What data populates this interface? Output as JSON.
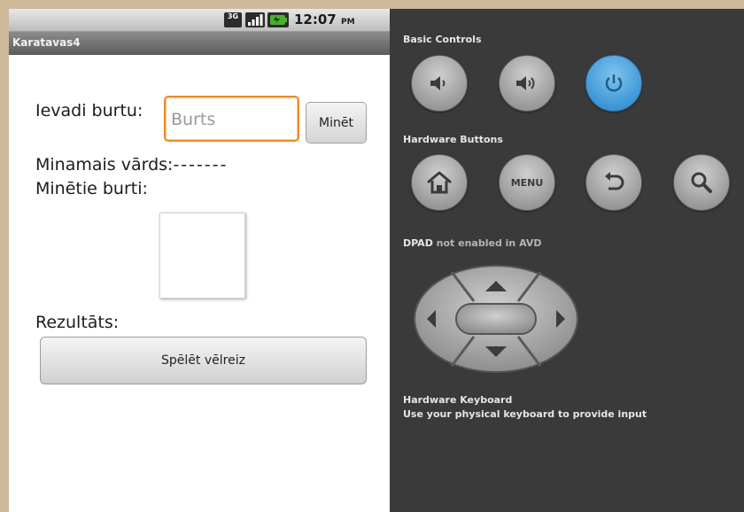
{
  "status_bar": {
    "network_badge": "3G",
    "time": "12:07",
    "ampm": "PM",
    "icons": [
      "3g-icon",
      "signal-icon",
      "battery-charging-icon"
    ]
  },
  "app": {
    "title": "Karatavas4",
    "enter_letter_label": "Ievadi burtu:",
    "letter_input_placeholder": "Burts",
    "letter_input_value": "",
    "guess_button": "Minēt",
    "word_label": "Minamais vārds:",
    "word_mask": "-------",
    "guessed_label": "Minētie burti:",
    "result_label": "Rezultāts:",
    "replay_button": "Spēlēt vēlreiz"
  },
  "controls": {
    "basic_controls_title": "Basic Controls",
    "hardware_buttons_title": "Hardware Buttons",
    "menu_label": "MENU",
    "dpad_title_bold": "DPAD",
    "dpad_title_rest": " not enabled in AVD",
    "keyboard_title": "Hardware Keyboard",
    "keyboard_desc": "Use your physical keyboard to provide input",
    "colors": {
      "power": "#3e97d6",
      "panel": "#3a3a3a",
      "focus": "#f08a24"
    }
  }
}
